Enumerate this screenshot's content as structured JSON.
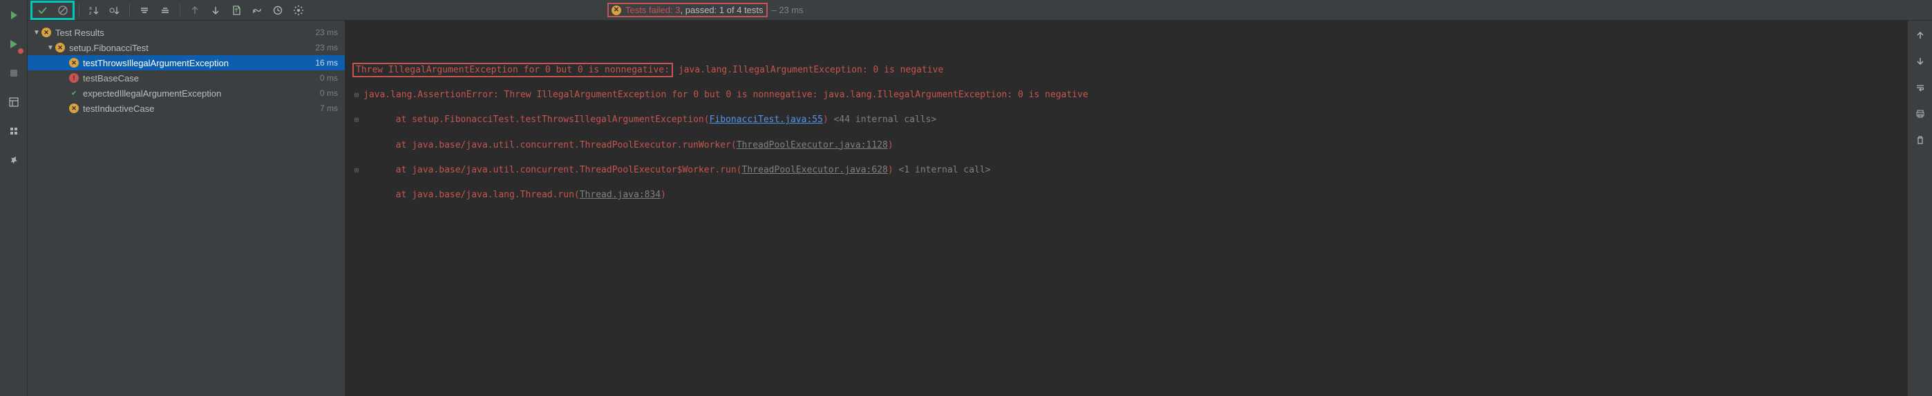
{
  "toolbar": {
    "status": {
      "failed_label": "Tests failed:",
      "failed_count": "3",
      "passed_label": ", passed:",
      "passed_count": "1",
      "total_label": "of 4 tests",
      "elapsed": "– 23 ms"
    }
  },
  "tree": {
    "root": {
      "label": "Test Results",
      "time": "23 ms",
      "status": "warn"
    },
    "suite": {
      "label": "setup.FibonacciTest",
      "time": "23 ms",
      "status": "warn"
    },
    "tests": [
      {
        "label": "testThrowsIllegalArgumentException",
        "time": "16 ms",
        "status": "warn",
        "selected": true
      },
      {
        "label": "testBaseCase",
        "time": "0 ms",
        "status": "err"
      },
      {
        "label": "expectedIllegalArgumentException",
        "time": "0 ms",
        "status": "pass"
      },
      {
        "label": "testInductiveCase",
        "time": "7 ms",
        "status": "warn"
      }
    ]
  },
  "console": {
    "header": {
      "msg": "Threw IllegalArgumentException for 0 but 0 is nonnegative:",
      "tail": " java.lang.IllegalArgumentException: 0 is negative"
    },
    "assertion": "java.lang.AssertionError: Threw IllegalArgumentException for 0 but 0 is nonnegative: java.lang.IllegalArgumentException: 0 is negative",
    "trace": [
      {
        "prefix": "\tat setup.FibonacciTest.testThrowsIllegalArgumentException(",
        "file": "FibonacciTest.java:55",
        "file_kind": "link",
        "suffix": ")",
        "note": " <44 internal calls>"
      },
      {
        "prefix": "\tat java.base/java.util.concurrent.ThreadPoolExecutor.runWorker(",
        "file": "ThreadPoolExecutor.java:1128",
        "file_kind": "grey",
        "suffix": ")",
        "note": ""
      },
      {
        "prefix": "\tat java.base/java.util.concurrent.ThreadPoolExecutor$Worker.run(",
        "file": "ThreadPoolExecutor.java:628",
        "file_kind": "grey",
        "suffix": ")",
        "note": " <1 internal call>"
      },
      {
        "prefix": "\tat java.base/java.lang.Thread.run(",
        "file": "Thread.java:834",
        "file_kind": "grey",
        "suffix": ")",
        "note": ""
      }
    ]
  }
}
